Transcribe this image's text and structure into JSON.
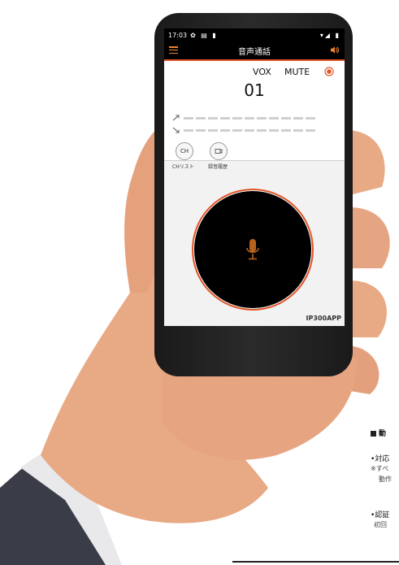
{
  "statusbar": {
    "time": "17:03",
    "left_icons": "✿ ▤ ▮",
    "right_icons": "▾◢ ▮"
  },
  "appbar": {
    "title": "音声通話"
  },
  "panel": {
    "vox_label": "VOX",
    "mute_label": "MUTE",
    "channel_number": "01"
  },
  "buttons": {
    "ch_icon_text": "CH",
    "ch_list_label": "CHリスト",
    "record_label": "録音履歴"
  },
  "app": {
    "name": "IP300APP"
  },
  "side_text": {
    "heading": "動",
    "line1": "•対応",
    "line2": "※すべ",
    "line3": "動作",
    "line4": "•認証",
    "line5": "初回"
  },
  "colors": {
    "accent": "#e25527",
    "menu": "#f08430",
    "mic": "#b5621f"
  }
}
